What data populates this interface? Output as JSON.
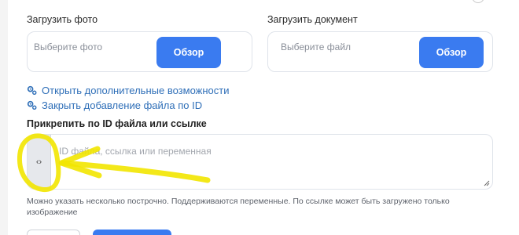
{
  "photo_upload": {
    "label": "Загрузить фото",
    "placeholder": "Выберите фото",
    "browse_label": "Обзор"
  },
  "document_upload": {
    "label": "Загрузить документ",
    "placeholder": "Выберите файл",
    "browse_label": "Обзор"
  },
  "links": {
    "open_extra": "Открыть дополнительные возможности",
    "close_file_id": "Закрыть добавление файла по ID"
  },
  "attach_by_id": {
    "label": "Прикрепить по ID файла или ссылке",
    "placeholder": "ID файла, ссылка или переменная",
    "variable_button": "‹›",
    "hint": "Можно указать несколько построчно. Поддерживаются переменные. По ссылке может быть загружено только изображение"
  },
  "annotation": {
    "color": "#f2e600"
  },
  "colors": {
    "accent": "#3a7bf0",
    "link": "#2f6fb8"
  }
}
